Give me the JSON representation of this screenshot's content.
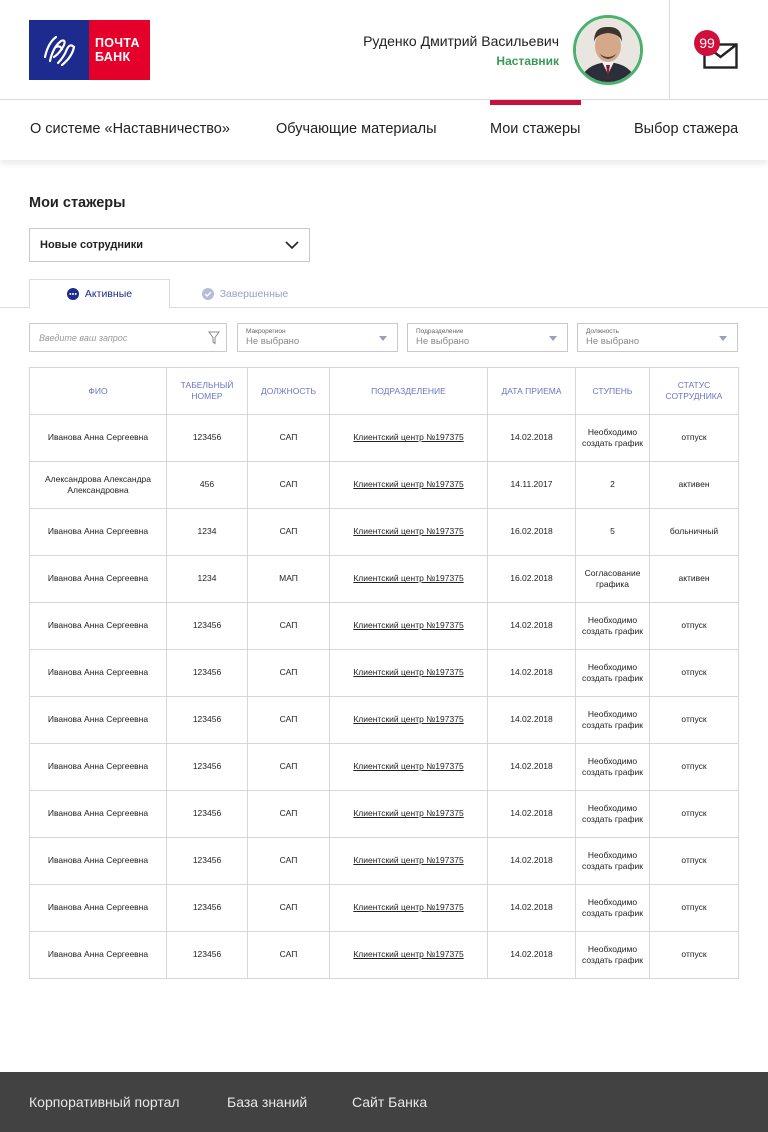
{
  "brand": {
    "logo_line1": "ПОЧТА",
    "logo_line2": "БАНК",
    "primary": "#1d2a8e",
    "accent": "#e4002b"
  },
  "user": {
    "name": "Руденко Дмитрий Васильевич",
    "role": "Наставник",
    "avatar_icon": "user-photo"
  },
  "notifications": {
    "count": "99",
    "icon": "mail-icon"
  },
  "nav": {
    "items": [
      {
        "label": "О системе «Наставничество»"
      },
      {
        "label": "Обучающие материалы"
      },
      {
        "label": "Мои стажеры",
        "active": true
      },
      {
        "label": "Выбор стажера"
      }
    ]
  },
  "page": {
    "title": "Мои стажеры",
    "group_select": "Новые сотрудники",
    "tabs": [
      {
        "label": "Активные",
        "active": true
      },
      {
        "label": "Завершенные",
        "active": false
      }
    ]
  },
  "filters": {
    "search_placeholder": "Введите ваш запрос",
    "dropdowns": [
      {
        "label": "Макрорегион",
        "value": "Не выбрано"
      },
      {
        "label": "Подразделение",
        "value": "Не выбрано"
      },
      {
        "label": "Должность",
        "value": "Не выбрано"
      }
    ]
  },
  "table": {
    "headers": [
      "ФИО",
      "Табельный номер",
      "Должность",
      "Подразделение",
      "Дата приема",
      "Ступень",
      "Статус сотрудника"
    ],
    "rows": [
      [
        "Иванова Анна Сергеевна",
        "123456",
        "САП",
        "Клиентский центр №197375",
        "14.02.2018",
        "Необходимо создать график",
        "отпуск"
      ],
      [
        "Александрова Александра Александровна",
        "456",
        "САП",
        "Клиентский центр №197375",
        "14.11.2017",
        "2",
        "активен"
      ],
      [
        "Иванова Анна Сергеевна",
        "1234",
        "САП",
        "Клиентский центр №197375",
        "16.02.2018",
        "5",
        "больничный"
      ],
      [
        "Иванова Анна Сергеевна",
        "1234",
        "МАП",
        "Клиентский центр №197375",
        "16.02.2018",
        "Согласование графика",
        "активен"
      ],
      [
        "Иванова Анна Сергеевна",
        "123456",
        "САП",
        "Клиентский центр №197375",
        "14.02.2018",
        "Необходимо создать график",
        "отпуск"
      ],
      [
        "Иванова Анна Сергеевна",
        "123456",
        "САП",
        "Клиентский центр №197375",
        "14.02.2018",
        "Необходимо создать график",
        "отпуск"
      ],
      [
        "Иванова Анна Сергеевна",
        "123456",
        "САП",
        "Клиентский центр №197375",
        "14.02.2018",
        "Необходимо создать график",
        "отпуск"
      ],
      [
        "Иванова Анна Сергеевна",
        "123456",
        "САП",
        "Клиентский центр №197375",
        "14.02.2018",
        "Необходимо создать график",
        "отпуск"
      ],
      [
        "Иванова Анна Сергеевна",
        "123456",
        "САП",
        "Клиентский центр №197375",
        "14.02.2018",
        "Необходимо создать график",
        "отпуск"
      ],
      [
        "Иванова Анна Сергеевна",
        "123456",
        "САП",
        "Клиентский центр №197375",
        "14.02.2018",
        "Необходимо создать график",
        "отпуск"
      ],
      [
        "Иванова Анна Сергеевна",
        "123456",
        "САП",
        "Клиентский центр №197375",
        "14.02.2018",
        "Необходимо создать график",
        "отпуск"
      ],
      [
        "Иванова Анна Сергеевна",
        "123456",
        "САП",
        "Клиентский центр №197375",
        "14.02.2018",
        "Необходимо создать график",
        "отпуск"
      ]
    ]
  },
  "footer": {
    "links": [
      {
        "label": "Корпоративный портал"
      },
      {
        "label": "База знаний"
      },
      {
        "label": "Сайт Банка"
      }
    ]
  }
}
